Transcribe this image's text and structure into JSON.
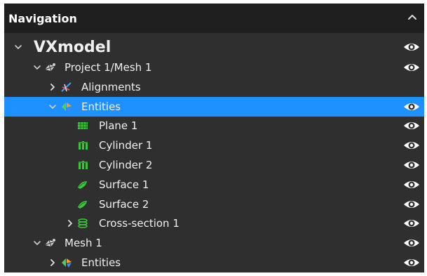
{
  "panel": {
    "title": "Navigation"
  },
  "tree": [
    {
      "id": "vxmodel",
      "label": "VXmodel",
      "level": 0,
      "expand": "expanded",
      "icon": "none",
      "eye": true,
      "selected": false,
      "root": true
    },
    {
      "id": "project-mesh",
      "label": "Project 1/Mesh 1",
      "level": 1,
      "expand": "expanded",
      "icon": "mesh-icon",
      "eye": true,
      "selected": false
    },
    {
      "id": "alignments",
      "label": "Alignments",
      "level": 2,
      "expand": "collapsed",
      "icon": "alignments-icon",
      "eye": false,
      "selected": false
    },
    {
      "id": "entities",
      "label": "Entities",
      "level": 2,
      "expand": "expanded",
      "icon": "entities-icon",
      "eye": true,
      "selected": true
    },
    {
      "id": "plane-1",
      "label": "Plane 1",
      "level": 3,
      "expand": "none",
      "icon": "plane-icon",
      "eye": true,
      "selected": false
    },
    {
      "id": "cylinder-1",
      "label": "Cylinder 1",
      "level": 3,
      "expand": "none",
      "icon": "cylinder-icon",
      "eye": true,
      "selected": false
    },
    {
      "id": "cylinder-2",
      "label": "Cylinder 2",
      "level": 3,
      "expand": "none",
      "icon": "cylinder-icon",
      "eye": true,
      "selected": false
    },
    {
      "id": "surface-1",
      "label": "Surface 1",
      "level": 3,
      "expand": "none",
      "icon": "surface-icon",
      "eye": true,
      "selected": false
    },
    {
      "id": "surface-2",
      "label": "Surface 2",
      "level": 3,
      "expand": "none",
      "icon": "surface-icon",
      "eye": true,
      "selected": false
    },
    {
      "id": "cross-section-1",
      "label": "Cross-section 1",
      "level": 3,
      "expand": "collapsed",
      "icon": "cross-section-icon",
      "eye": true,
      "selected": false
    },
    {
      "id": "mesh-1",
      "label": "Mesh 1",
      "level": 1,
      "expand": "expanded",
      "icon": "mesh-icon",
      "eye": true,
      "selected": false
    },
    {
      "id": "entities-2",
      "label": "Entities",
      "level": 2,
      "expand": "collapsed",
      "icon": "entities-icon",
      "eye": true,
      "selected": false
    }
  ]
}
